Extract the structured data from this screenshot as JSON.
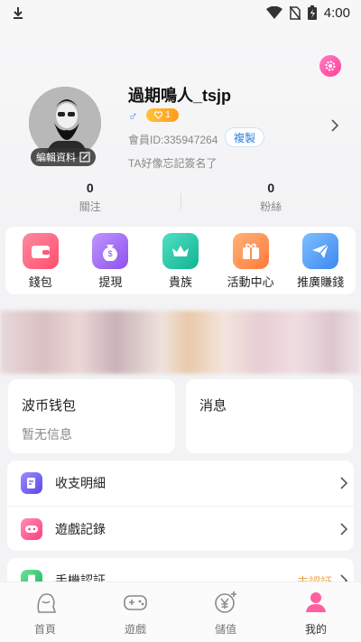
{
  "status_bar": {
    "time": "4:00"
  },
  "profile": {
    "username": "過期鳴人_tsjp",
    "gender_symbol": "♂",
    "level": "1",
    "member_id": "會員ID:335947264",
    "copy_label": "複製",
    "signature": "TA好像忘記簽名了",
    "edit_label": "編輯資料"
  },
  "stats": [
    {
      "value": "0",
      "label": "關注"
    },
    {
      "value": "0",
      "label": "粉絲"
    }
  ],
  "quick_actions": [
    {
      "label": "錢包",
      "icon": "wallet-icon",
      "color": "#ff5a7a"
    },
    {
      "label": "提現",
      "icon": "money-bag-icon",
      "color": "#a66cf2"
    },
    {
      "label": "貴族",
      "icon": "crown-icon",
      "color": "#23c7a8"
    },
    {
      "label": "活動中心",
      "icon": "gift-icon",
      "color": "#ff8f4a"
    },
    {
      "label": "推廣賺錢",
      "icon": "paper-plane-icon",
      "color": "#4a9cf5"
    }
  ],
  "wallet_card": {
    "title": "波币钱包",
    "subtitle": "暂无信息"
  },
  "message_card": {
    "title": "消息"
  },
  "menu": [
    {
      "label": "收支明細",
      "icon": "document-edit-icon",
      "color": "#6a5cf0"
    },
    {
      "label": "遊戲記錄",
      "icon": "gamepad-icon",
      "color": "#ff5b92"
    },
    {
      "label": "手機認証",
      "icon": "phone-icon",
      "color": "#28c46d",
      "status": "未認証"
    }
  ],
  "tabs": [
    {
      "label": "首頁",
      "icon": "girl-avatar-icon"
    },
    {
      "label": "遊戲",
      "icon": "gamepad-icon"
    },
    {
      "label": "儲值",
      "icon": "yen-coin-icon"
    },
    {
      "label": "我的",
      "icon": "person-icon",
      "active": true
    }
  ],
  "colors": {
    "accent": "#ff4f9a",
    "link": "#2f7fe0",
    "warning": "#e8a24a"
  }
}
